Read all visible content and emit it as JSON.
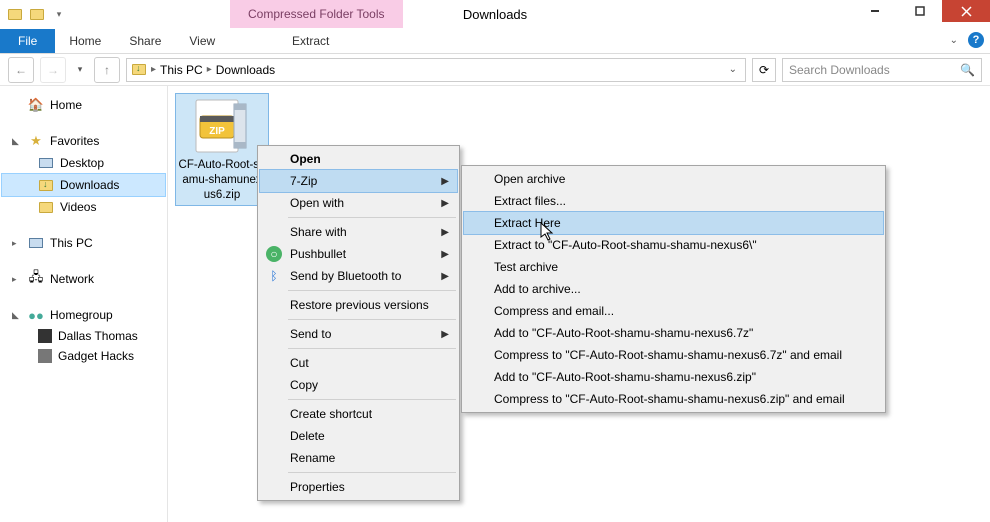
{
  "titlebar": {
    "contextual_tab": "Compressed Folder Tools",
    "title": "Downloads"
  },
  "ribbon": {
    "file": "File",
    "home": "Home",
    "share": "Share",
    "view": "View",
    "extract": "Extract"
  },
  "address": {
    "crumb1": "This PC",
    "crumb2": "Downloads",
    "search_placeholder": "Search Downloads"
  },
  "nav": {
    "home": "Home",
    "favorites": "Favorites",
    "desktop": "Desktop",
    "downloads": "Downloads",
    "videos": "Videos",
    "this_pc": "This PC",
    "network": "Network",
    "homegroup": "Homegroup",
    "dallas": "Dallas Thomas",
    "gadget": "Gadget Hacks"
  },
  "file": {
    "name": "CF-Auto-Root-shamu-shamunexus6.zip",
    "name_display": "CF-Auto-Root-shamu-shamunexus6.zip"
  },
  "ctx1": {
    "open": "Open",
    "sevenzip": "7-Zip",
    "open_with": "Open with",
    "share_with": "Share with",
    "pushbullet": "Pushbullet",
    "bluetooth": "Send by Bluetooth to",
    "restore": "Restore previous versions",
    "send_to": "Send to",
    "cut": "Cut",
    "copy": "Copy",
    "shortcut": "Create shortcut",
    "delete": "Delete",
    "rename": "Rename",
    "properties": "Properties"
  },
  "ctx2": {
    "open_archive": "Open archive",
    "extract_files": "Extract files...",
    "extract_here": "Extract Here",
    "extract_to": "Extract to \"CF-Auto-Root-shamu-shamu-nexus6\\\"",
    "test": "Test archive",
    "add_archive": "Add to archive...",
    "compress_email": "Compress and email...",
    "add_7z": "Add to \"CF-Auto-Root-shamu-shamu-nexus6.7z\"",
    "compress_7z_email": "Compress to \"CF-Auto-Root-shamu-shamu-nexus6.7z\" and email",
    "add_zip": "Add to \"CF-Auto-Root-shamu-shamu-nexus6.zip\"",
    "compress_zip_email": "Compress to \"CF-Auto-Root-shamu-shamu-nexus6.zip\" and email"
  }
}
